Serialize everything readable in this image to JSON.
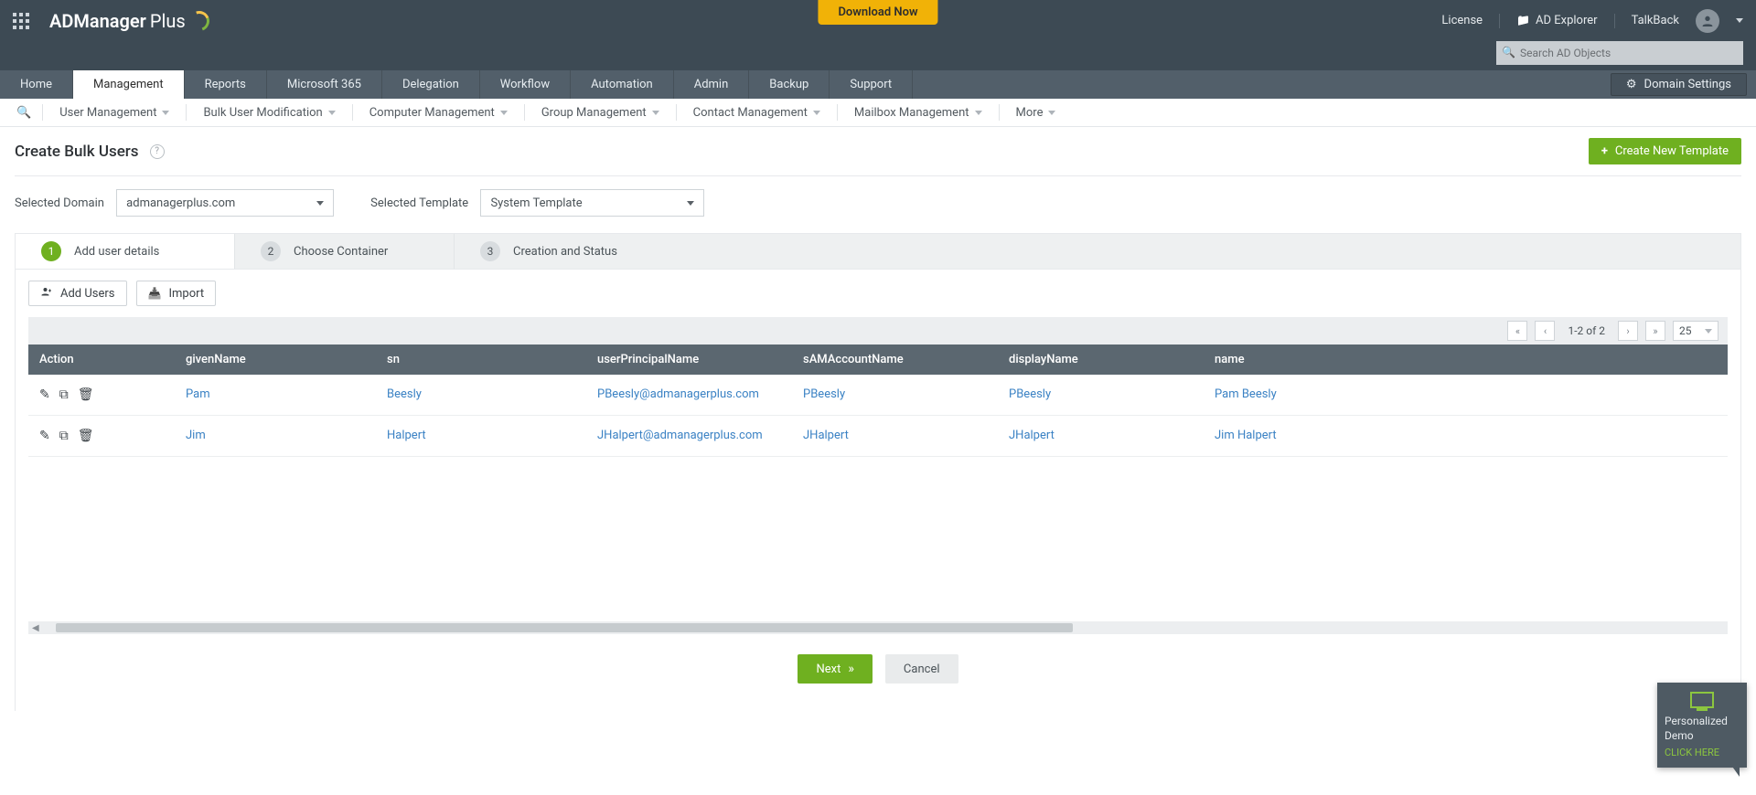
{
  "top": {
    "brand_bold": "ADManager",
    "brand_light": "Plus",
    "download": "Download Now",
    "license": "License",
    "explorer": "AD Explorer",
    "talkback": "TalkBack",
    "search_placeholder": "Search AD Objects"
  },
  "mainnav": {
    "items": [
      "Home",
      "Management",
      "Reports",
      "Microsoft 365",
      "Delegation",
      "Workflow",
      "Automation",
      "Admin",
      "Backup",
      "Support"
    ],
    "active_index": 1,
    "domain_settings": "Domain Settings"
  },
  "subnav": {
    "items": [
      "User Management",
      "Bulk User Modification",
      "Computer Management",
      "Group Management",
      "Contact Management",
      "Mailbox Management",
      "More"
    ]
  },
  "page": {
    "title": "Create Bulk Users",
    "create_template_btn": "Create New Template",
    "domain_label": "Selected Domain",
    "domain_value": "admanagerplus.com",
    "template_label": "Selected Template",
    "template_value": "System Template"
  },
  "steps": [
    {
      "num": "1",
      "label": "Add user details"
    },
    {
      "num": "2",
      "label": "Choose Container"
    },
    {
      "num": "3",
      "label": "Creation and Status"
    }
  ],
  "active_step_index": 0,
  "buttons": {
    "add_users": "Add Users",
    "import": "Import",
    "next": "Next",
    "cancel": "Cancel"
  },
  "pager": {
    "info": "1-2 of 2",
    "page_size": "25"
  },
  "table": {
    "columns": [
      "Action",
      "givenName",
      "sn",
      "userPrincipalName",
      "sAMAccountName",
      "displayName",
      "name"
    ],
    "rows": [
      {
        "givenName": "Pam",
        "sn": "Beesly",
        "userPrincipalName": "PBeesly@admanagerplus.com",
        "sAMAccountName": "PBeesly",
        "displayName": "PBeesly",
        "name": "Pam Beesly"
      },
      {
        "givenName": "Jim",
        "sn": "Halpert",
        "userPrincipalName": "JHalpert@admanagerplus.com",
        "sAMAccountName": "JHalpert",
        "displayName": "JHalpert",
        "name": "Jim Halpert"
      }
    ]
  },
  "demo": {
    "line1": "Personalized Demo",
    "click": "CLICK HERE"
  }
}
